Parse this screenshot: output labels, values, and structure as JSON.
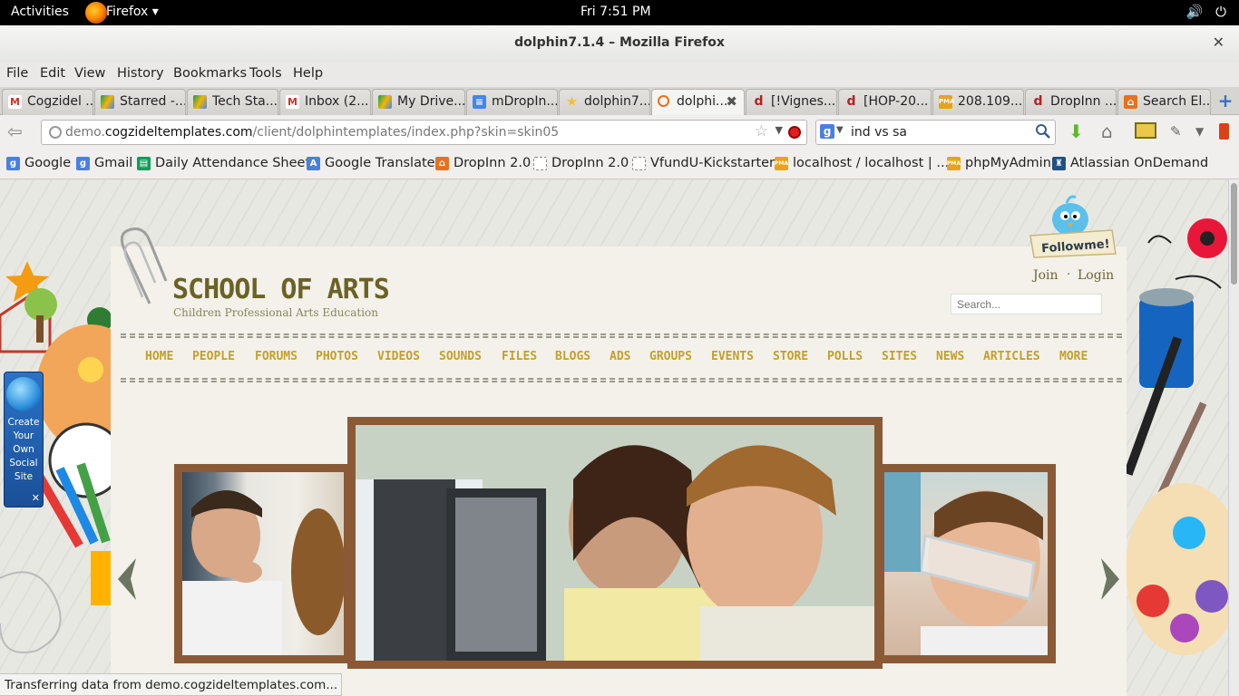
{
  "topbar": {
    "activities": "Activities",
    "app": "Firefox ▾",
    "clock": "Fri  7:51 PM"
  },
  "window": {
    "title": "dolphin7.1.4 – Mozilla Firefox"
  },
  "menu": [
    "File",
    "Edit",
    "View",
    "History",
    "Bookmarks",
    "Tools",
    "Help"
  ],
  "tabs": [
    {
      "label": "Cogzidel ...",
      "icon": "gmail-icon",
      "color": "#d93025"
    },
    {
      "label": "Starred -...",
      "icon": "drive-icon",
      "color": "#f4b400"
    },
    {
      "label": "Tech Sta...",
      "icon": "drive-icon",
      "color": "#0f9d58"
    },
    {
      "label": "Inbox (2...",
      "icon": "gmail-icon",
      "color": "#d93025"
    },
    {
      "label": "My Drive...",
      "icon": "drive-icon",
      "color": "#f4b400"
    },
    {
      "label": "mDropIn...",
      "icon": "docs-icon",
      "color": "#4285f4"
    },
    {
      "label": "dolphin7....",
      "icon": "star-icon",
      "color": "#f1c232"
    },
    {
      "label": "dolphi...",
      "icon": "loading-icon",
      "color": "#e8711a"
    },
    {
      "label": "[!Vignes...",
      "icon": "app-icon",
      "color": "#b22222"
    },
    {
      "label": "[HOP-20...",
      "icon": "app-icon",
      "color": "#b22222"
    },
    {
      "label": "208.109....",
      "icon": "pma-icon",
      "color": "#e8a317"
    },
    {
      "label": "DropInn ...",
      "icon": "app-icon",
      "color": "#b22222"
    },
    {
      "label": "Search El...",
      "icon": "dropinn-icon",
      "color": "#e8711a"
    }
  ],
  "nav": {
    "url_prefix": "demo.",
    "url_domain": "cogzideltemplates.com",
    "url_path": "/client/dolphintemplates/index.php?skin=skin05",
    "search_value": "ind vs sa"
  },
  "bookmarks": [
    {
      "label": "Google",
      "icon": "google-icon",
      "color": "#4a7fe0"
    },
    {
      "label": "Gmail",
      "icon": "google-icon",
      "color": "#4a7fe0"
    },
    {
      "label": "Daily Attendance Sheet",
      "icon": "sheets-icon",
      "color": "#0f9d58"
    },
    {
      "label": "Google Translate",
      "icon": "translate-icon",
      "color": "#4a7fe0"
    },
    {
      "label": "DropInn 2.0",
      "icon": "dropinn-icon",
      "color": "#e8711a"
    },
    {
      "label": "DropInn 2.0",
      "icon": "page-icon",
      "color": "#ffffff"
    },
    {
      "label": "VfundU-Kickstarter",
      "icon": "page-icon",
      "color": "#ffffff"
    },
    {
      "label": "localhost / localhost | ...",
      "icon": "pma-icon",
      "color": "#e8a317"
    },
    {
      "label": "phpMyAdmin",
      "icon": "pma-icon",
      "color": "#e8a317"
    },
    {
      "label": "Atlassian OnDemand",
      "icon": "atlassian-icon",
      "color": "#205081"
    }
  ],
  "site": {
    "title": "SCHOOL OF ARTS",
    "tagline": "Children Professional Arts Education",
    "join": "Join",
    "separator": "·",
    "login": "Login",
    "search_placeholder": "Search...",
    "followme": "Followme!",
    "nav": [
      "HOME",
      "PEOPLE",
      "FORUMS",
      "PHOTOS",
      "VIDEOS",
      "SOUNDS",
      "FILES",
      "BLOGS",
      "ADS",
      "GROUPS",
      "EVENTS",
      "STORE",
      "POLLS",
      "SITES",
      "NEWS",
      "ARTICLES",
      "MORE"
    ],
    "social_widget": "Create Your Own Social Site"
  },
  "status": "Transferring data from demo.cogzideltemplates.com..."
}
